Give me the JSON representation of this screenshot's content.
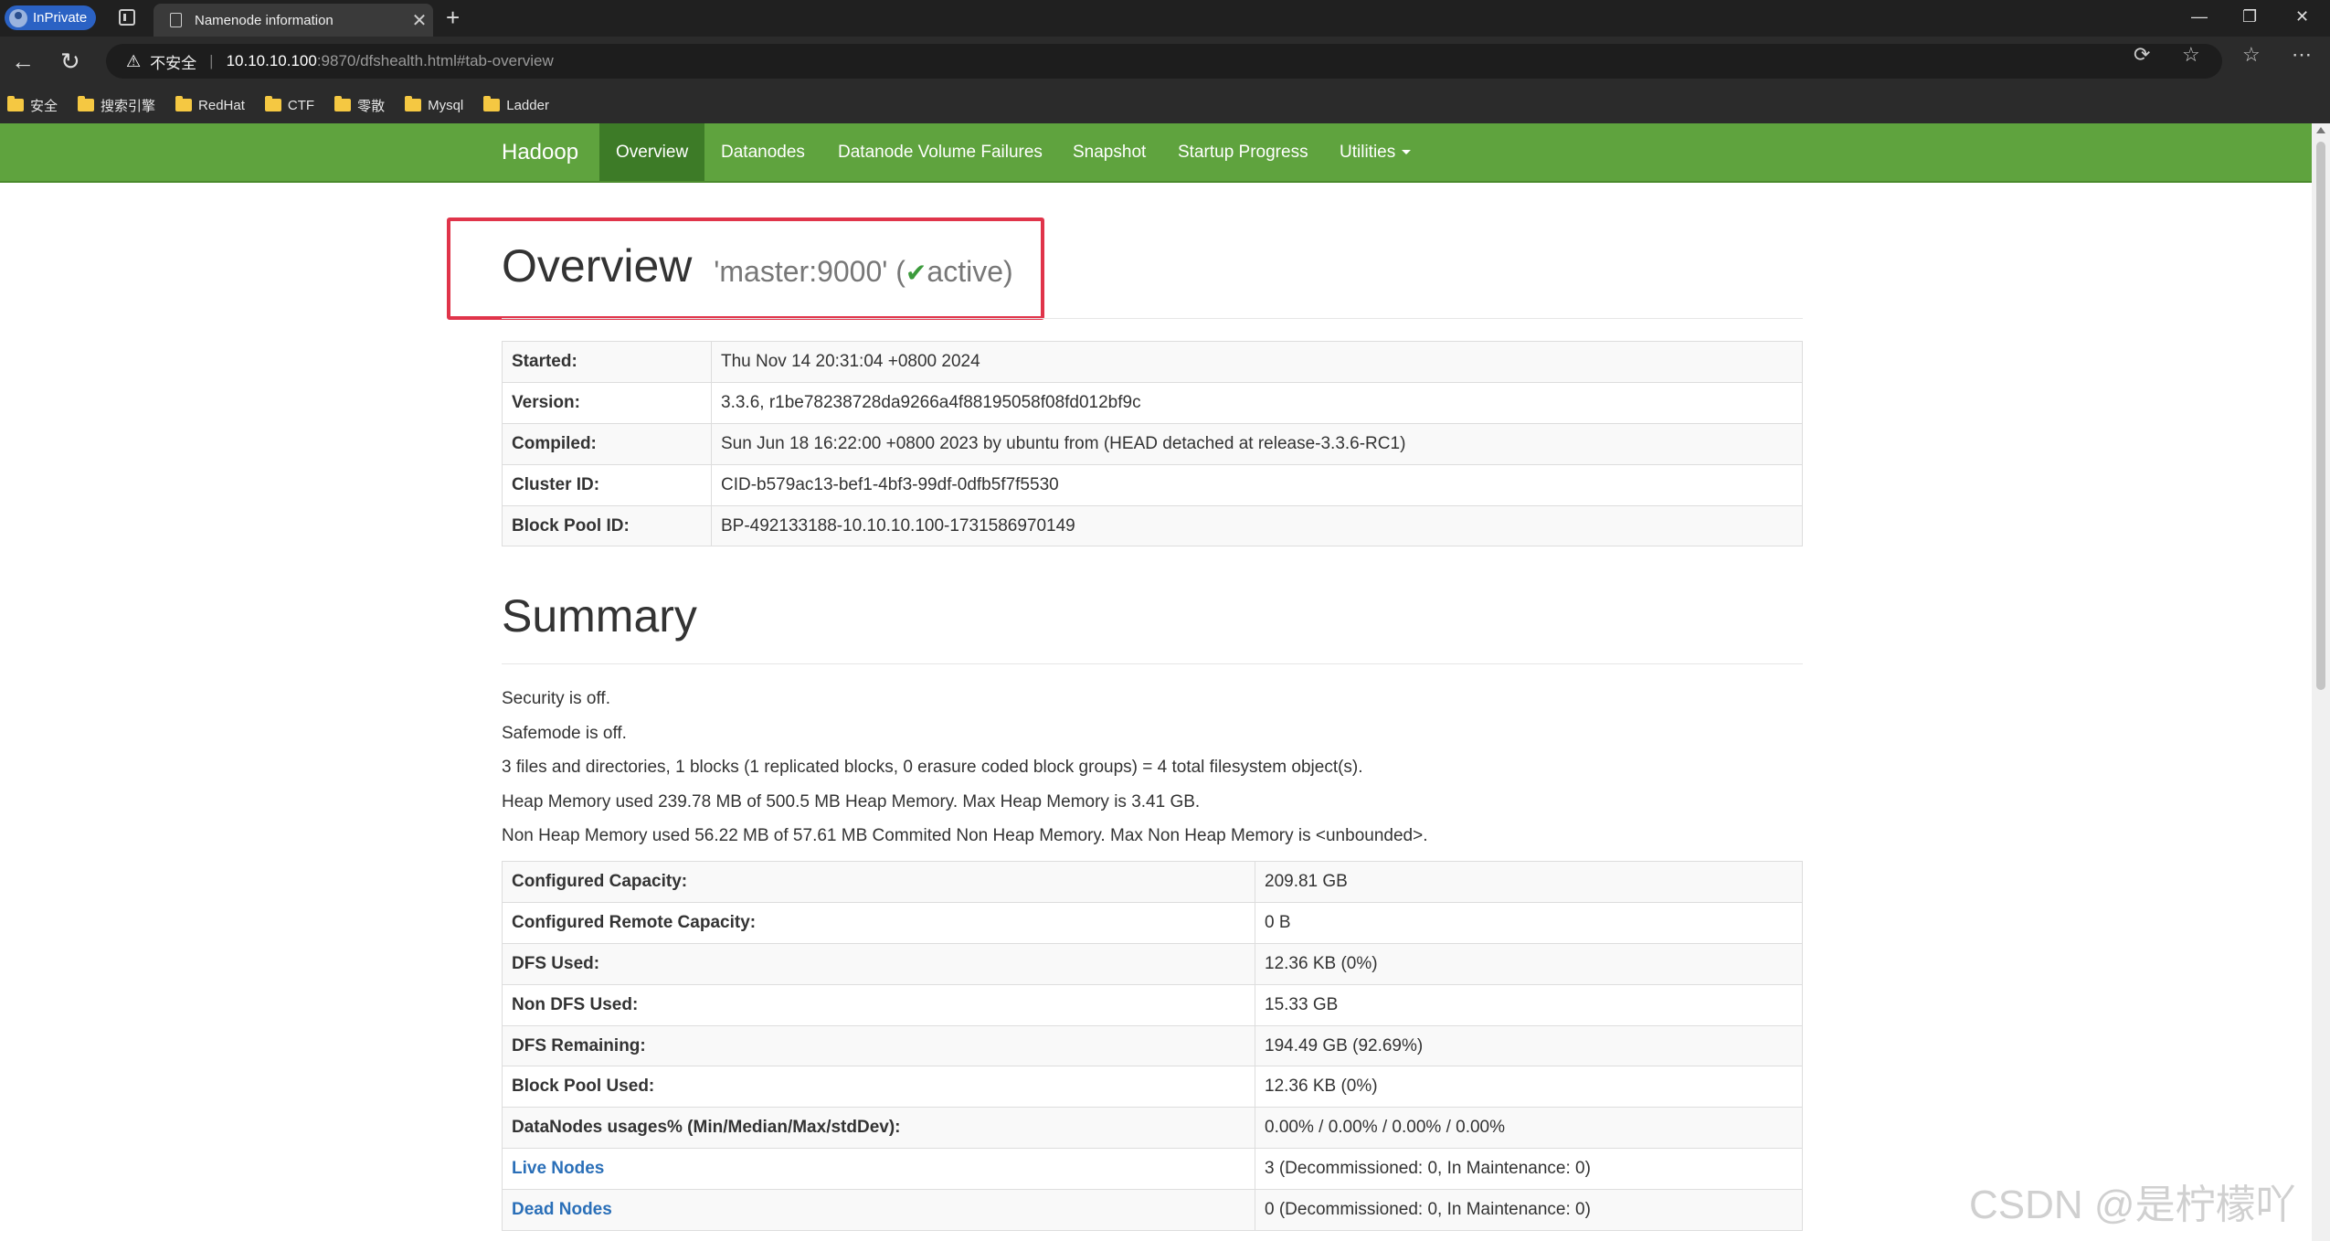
{
  "browser": {
    "inprivate_label": "InPrivate",
    "tab_title": "Namenode information",
    "tab_close": "✕",
    "new_tab": "+",
    "url_warning": "不安全",
    "url_host": "10.10.10.100",
    "url_path": ":9870/dfshealth.html#tab-overview",
    "bookmarks": [
      "安全",
      "搜索引擎",
      "RedHat",
      "CTF",
      "零散",
      "Mysql",
      "Ladder"
    ]
  },
  "nav": {
    "brand": "Hadoop",
    "items": [
      "Overview",
      "Datanodes",
      "Datanode Volume Failures",
      "Snapshot",
      "Startup Progress",
      "Utilities"
    ],
    "active": "Overview"
  },
  "overview": {
    "title": "Overview",
    "host": "'master:9000'",
    "status_open": "(",
    "status": "active",
    "status_close": ")",
    "rows": [
      {
        "key": "Started:",
        "value": "Thu Nov 14 20:31:04 +0800 2024"
      },
      {
        "key": "Version:",
        "value": "3.3.6, r1be78238728da9266a4f88195058f08fd012bf9c"
      },
      {
        "key": "Compiled:",
        "value": "Sun Jun 18 16:22:00 +0800 2023 by ubuntu from (HEAD detached at release-3.3.6-RC1)"
      },
      {
        "key": "Cluster ID:",
        "value": "CID-b579ac13-bef1-4bf3-99df-0dfb5f7f5530"
      },
      {
        "key": "Block Pool ID:",
        "value": "BP-492133188-10.10.10.100-1731586970149"
      }
    ]
  },
  "summary": {
    "title": "Summary",
    "lines": [
      "Security is off.",
      "Safemode is off.",
      "3 files and directories, 1 blocks (1 replicated blocks, 0 erasure coded block groups) = 4 total filesystem object(s).",
      "Heap Memory used 239.78 MB of 500.5 MB Heap Memory. Max Heap Memory is 3.41 GB.",
      "Non Heap Memory used 56.22 MB of 57.61 MB Commited Non Heap Memory. Max Non Heap Memory is <unbounded>."
    ],
    "rows": [
      {
        "key": "Configured Capacity:",
        "value": "209.81 GB"
      },
      {
        "key": "Configured Remote Capacity:",
        "value": "0 B"
      },
      {
        "key": "DFS Used:",
        "value": "12.36 KB (0%)"
      },
      {
        "key": "Non DFS Used:",
        "value": "15.33 GB"
      },
      {
        "key": "DFS Remaining:",
        "value": "194.49 GB (92.69%)"
      },
      {
        "key": "Block Pool Used:",
        "value": "12.36 KB (0%)"
      },
      {
        "key": "DataNodes usages% (Min/Median/Max/stdDev):",
        "value": "0.00% / 0.00% / 0.00% / 0.00%"
      },
      {
        "key": "Live Nodes",
        "value": "3 (Decommissioned: 0, In Maintenance: 0)",
        "link": true
      },
      {
        "key": "Dead Nodes",
        "value": "0 (Decommissioned: 0, In Maintenance: 0)",
        "link": true
      }
    ]
  },
  "watermark": "CSDN @是柠檬吖"
}
